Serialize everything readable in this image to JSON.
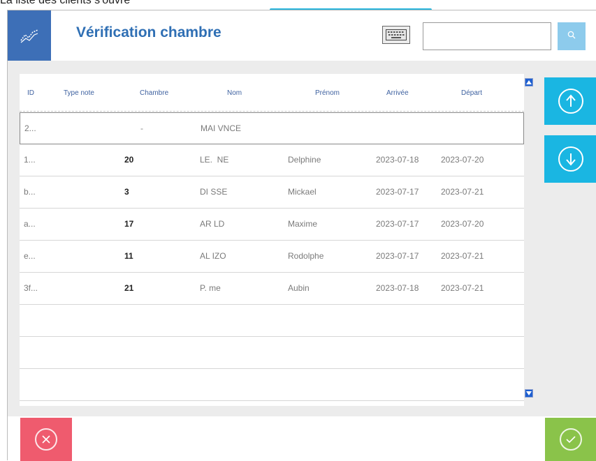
{
  "caption": "La liste des clients s'ouvre",
  "header": {
    "title": "Vérification chambre",
    "search_value": ""
  },
  "table": {
    "columns": [
      "ID",
      "Type note",
      "Chambre",
      "Nom",
      "Prénom",
      "Arrivée",
      "Départ"
    ],
    "rows": [
      {
        "id": "2...",
        "type": "",
        "room": "-",
        "nom": "MAI      VNCE",
        "prenom": "",
        "arrivee": "",
        "depart": ""
      },
      {
        "id": "1...",
        "type": "",
        "room": "20",
        "nom": "LE.     NE",
        "prenom": "Delphine",
        "arrivee": "2023-07-18",
        "depart": "2023-07-20"
      },
      {
        "id": "b...",
        "type": "",
        "room": "3",
        "nom": "DI     SSE",
        "prenom": "Mickael",
        "arrivee": "2023-07-17",
        "depart": "2023-07-21"
      },
      {
        "id": "a...",
        "type": "",
        "room": "17",
        "nom": "AR      LD",
        "prenom": "Maxime",
        "arrivee": "2023-07-17",
        "depart": "2023-07-20"
      },
      {
        "id": "e...",
        "type": "",
        "room": "11",
        "nom": "AL    IZO",
        "prenom": "Rodolphe",
        "arrivee": "2023-07-17",
        "depart": "2023-07-21"
      },
      {
        "id": "3f...",
        "type": "",
        "room": "21",
        "nom": "P.    me",
        "prenom": "Aubin",
        "arrivee": "2023-07-18",
        "depart": "2023-07-21"
      },
      {
        "id": "",
        "type": "",
        "room": "",
        "nom": "",
        "prenom": "",
        "arrivee": "",
        "depart": ""
      },
      {
        "id": "",
        "type": "",
        "room": "",
        "nom": "",
        "prenom": "",
        "arrivee": "",
        "depart": ""
      },
      {
        "id": "",
        "type": "",
        "room": "",
        "nom": "",
        "prenom": "",
        "arrivee": "",
        "depart": ""
      }
    ]
  },
  "icons": {
    "logo": "chart-line-icon",
    "keyboard": "keyboard-icon",
    "search": "search-icon",
    "scroll_up": "arrow-up-icon",
    "scroll_down": "arrow-down-icon",
    "cancel": "close-icon",
    "confirm": "check-icon"
  },
  "colors": {
    "accent": "#1ab6e2",
    "title": "#2f6fb4",
    "logo_bg": "#3d6fb7",
    "cancel": "#ef5b6e",
    "confirm": "#8ac34a"
  }
}
